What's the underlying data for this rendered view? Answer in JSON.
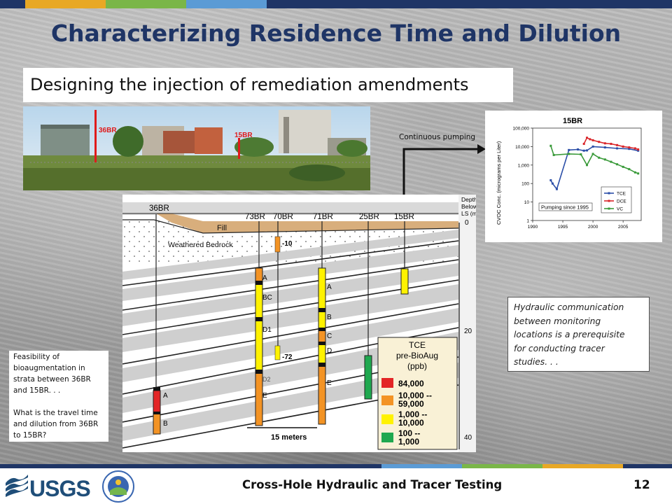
{
  "slide": {
    "title": "Characterizing Residence Time and Dilution",
    "subtitle": "Designing the injection of remediation amendments",
    "footer_title": "Cross-Hole Hydraulic and Tracer Testing",
    "page_number": "12",
    "top_bar_colors": [
      "#1f3566",
      "#e8a825",
      "#7ab648",
      "#5b9bd5",
      "#1f3566"
    ],
    "bottom_bar_colors": [
      "#1f3566",
      "#5b9bd5",
      "#7ab648",
      "#e8a825",
      "#1f3566"
    ]
  },
  "photo": {
    "labels": [
      "36BR",
      "15BR"
    ]
  },
  "pumping_label": "Continuous pumping",
  "chart": {
    "chart_data": {
      "type": "line",
      "title": "15BR",
      "ylabel": "CVOC Conc. (micrograms per Liter)",
      "y_scale": "log",
      "ylim": [
        1,
        100000
      ],
      "yticks": [
        "1",
        "10",
        "100",
        "1,000",
        "10,000",
        "100,000"
      ],
      "xlim": [
        1990,
        2008
      ],
      "xticks": [
        "1990",
        "1995",
        "2000",
        "2005"
      ],
      "annotation": "Pumping since 1995",
      "legend_position": "bottom-right",
      "series": [
        {
          "name": "TCE",
          "color": "#2c4fa8",
          "x": [
            1993,
            1993.3,
            1994,
            1996,
            1997.5,
            1998.5,
            1999,
            2000,
            2002,
            2004,
            2006,
            2007.5
          ],
          "values": [
            150,
            100,
            50,
            6500,
            7000,
            6000,
            6200,
            10000,
            9000,
            8000,
            7500,
            6000
          ]
        },
        {
          "name": "DCE",
          "color": "#d9262a",
          "x": [
            1998.5,
            1999,
            1999.5,
            2000,
            2001,
            2002,
            2003,
            2004,
            2005,
            2006,
            2007,
            2007.5
          ],
          "values": [
            14000,
            30000,
            25000,
            22000,
            18000,
            15000,
            14000,
            12000,
            10000,
            9000,
            8000,
            7000
          ]
        },
        {
          "name": "VC",
          "color": "#3a9a3a",
          "x": [
            1993,
            1993.5,
            1996,
            1998,
            1999,
            2000,
            2001,
            2002,
            2003,
            2004,
            2005,
            2006,
            2007,
            2007.5
          ],
          "values": [
            11000,
            3500,
            4000,
            3800,
            1000,
            4000,
            2500,
            2000,
            1500,
            1100,
            800,
            600,
            400,
            350
          ]
        }
      ]
    }
  },
  "xsection": {
    "wells": [
      "36BR",
      "73BR",
      "70BR",
      "71BR",
      "25BR",
      "15BR"
    ],
    "layers": [
      "Fill",
      "Weathered Bedrock"
    ],
    "depth_header": [
      "Depth",
      "Below",
      "LS (m)"
    ],
    "depth_ticks": [
      "0",
      "20",
      "40"
    ],
    "interval_labels_36br": [
      "A",
      "B"
    ],
    "interval_labels_73br": [
      "A",
      "BC",
      "D1",
      "D2",
      "E"
    ],
    "interval_labels_71br": [
      "A",
      "B",
      "C",
      "D",
      "E"
    ],
    "interval_labels_70br": [
      "-10",
      "-72"
    ],
    "scale_bar": "15 meters",
    "legend": {
      "title_lines": [
        "TCE",
        "pre-BioAug",
        "(ppb)"
      ],
      "items": [
        {
          "lines": [
            "84,000"
          ],
          "color": "#e32526"
        },
        {
          "lines": [
            "10,000 --",
            "59,000"
          ],
          "color": "#f39324"
        },
        {
          "lines": [
            "1,000 --",
            "10,000"
          ],
          "color": "#fff200"
        },
        {
          "lines": [
            "100 --",
            "1,000"
          ],
          "color": "#1fa84f"
        }
      ]
    }
  },
  "notes": {
    "right_lines": [
      "Hydraulic communication",
      "between monitoring",
      "locations is a prerequisite",
      "for conducting tracer",
      "studies. . ."
    ],
    "left_lines": [
      "Feasibility of",
      "bioaugmentation in",
      "strata between 36BR",
      "and 15BR. . .",
      "",
      "What is the travel time",
      "and dilution from 36BR",
      "to 15BR?"
    ]
  },
  "logos": {
    "usgs_text": "USGS"
  }
}
